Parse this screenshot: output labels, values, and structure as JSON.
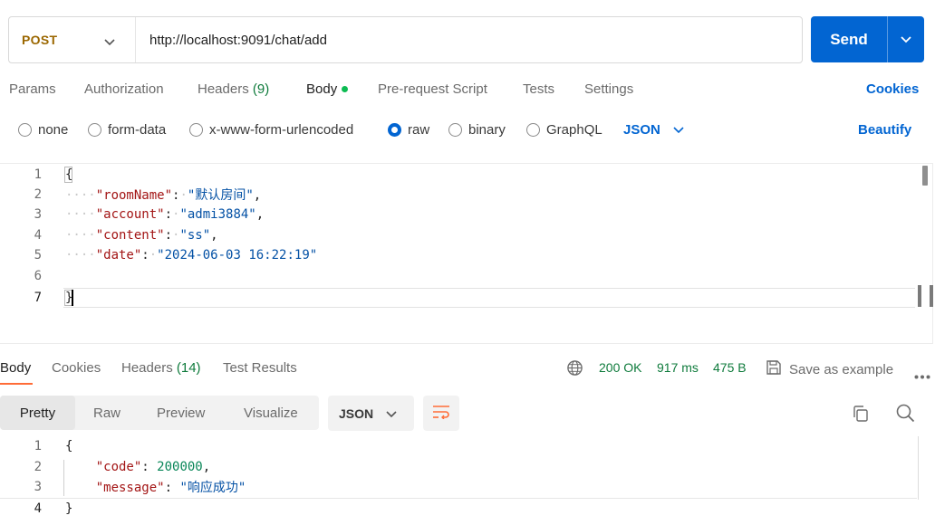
{
  "request": {
    "method": "POST",
    "url": "http://localhost:9091/chat/add",
    "send_label": "Send"
  },
  "request_tabs": {
    "params": "Params",
    "authorization": "Authorization",
    "headers": "Headers",
    "headers_count": "(9)",
    "body": "Body",
    "prerequest": "Pre-request Script",
    "tests": "Tests",
    "settings": "Settings",
    "cookies": "Cookies"
  },
  "body_types": {
    "none": "none",
    "form_data": "form-data",
    "urlencoded": "x-www-form-urlencoded",
    "raw": "raw",
    "binary": "binary",
    "graphql": "GraphQL",
    "selected": "raw",
    "language": "JSON",
    "beautify": "Beautify"
  },
  "request_body": {
    "line_numbers": [
      "1",
      "2",
      "3",
      "4",
      "5",
      "6",
      "7"
    ],
    "open_brace": "{",
    "close_brace": "}",
    "indent": "····",
    "fields": [
      {
        "key": "\"roomName\"",
        "value": "\"默认房间\""
      },
      {
        "key": "\"account\"",
        "value": "\"admi3884\""
      },
      {
        "key": "\"content\"",
        "value": "\"ss\""
      },
      {
        "key": "\"date\"",
        "value": "\"2024-06-03 16:22:19\""
      }
    ]
  },
  "response_tabs": {
    "body": "Body",
    "cookies": "Cookies",
    "headers": "Headers",
    "headers_count": "(14)",
    "test_results": "Test Results"
  },
  "response_meta": {
    "status": "200 OK",
    "time": "917 ms",
    "size": "475 B",
    "save_example": "Save as example"
  },
  "response_view": {
    "pretty": "Pretty",
    "raw": "Raw",
    "preview": "Preview",
    "visualize": "Visualize",
    "format": "JSON"
  },
  "response_body": {
    "line_numbers": [
      "1",
      "2",
      "3",
      "4"
    ],
    "open_brace": "{",
    "close_brace": "}",
    "code_key": "\"code\"",
    "code_value": "200000",
    "message_key": "\"message\"",
    "message_value": "\"响应成功\""
  },
  "colors": {
    "accent": "#0265d2",
    "method": "#9b6700",
    "success": "#0f7b3c",
    "active_tab": "#ff6c37",
    "json_key": "#a31515",
    "json_string": "#0451a5",
    "json_number": "#098658"
  }
}
